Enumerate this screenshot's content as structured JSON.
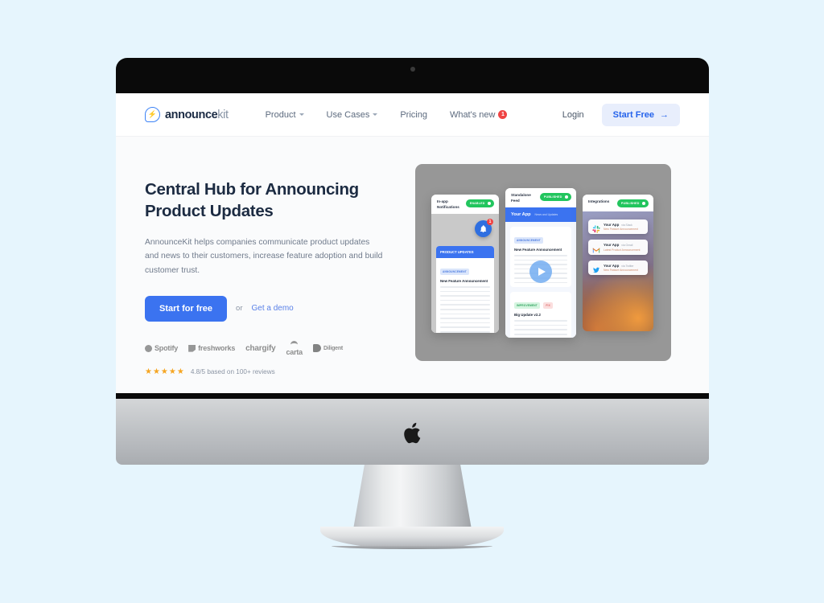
{
  "page": {
    "background_color": "#e6f5fd",
    "device": "imac-desktop-mockup"
  },
  "nav": {
    "brand": {
      "name_bold": "announce",
      "name_light": "kit",
      "icon": "announcekit-chat-logo"
    },
    "links": [
      {
        "label": "Product",
        "has_caret": true,
        "badge": null
      },
      {
        "label": "Use Cases",
        "has_caret": true,
        "badge": null
      },
      {
        "label": "Pricing",
        "has_caret": false,
        "badge": null
      },
      {
        "label": "What's new",
        "has_caret": false,
        "badge": "1"
      }
    ],
    "login_label": "Login",
    "cta_label": "Start Free",
    "cta_arrow": "→",
    "cta_bg": "#e8eefc",
    "cta_color": "#2563eb"
  },
  "hero": {
    "title_line1": "Central Hub for Announcing",
    "title_line2": "Product Updates",
    "subtitle": "AnnounceKit helps companies communicate product updates and news to their customers, increase feature adoption and build customer trust.",
    "primary_cta": "Start for free",
    "or_text": "or",
    "secondary_cta": "Get a demo",
    "primary_cta_bg": "#3b73f0",
    "logos": [
      {
        "name": "Spotify",
        "mark": "dot"
      },
      {
        "name": "freshworks",
        "mark": "square"
      },
      {
        "name": "chargify",
        "mark": "char"
      },
      {
        "name": "carta",
        "mark": "curve"
      },
      {
        "name": "Diligent",
        "mark": "dee"
      }
    ],
    "rating": {
      "stars": "★★★★★",
      "text": "4.8/5 based on 100+ reviews",
      "star_color": "#f5a623"
    }
  },
  "illustration": {
    "panel_color": "#979797",
    "watermark": "",
    "card1": {
      "title": "In-app\nNotifications",
      "pill": "ENABLED",
      "feed_header": "PRODUCT UPDATES",
      "tag": "ANNOUNCEMENT",
      "headline": "New Feature Announcement",
      "bell_count": "1"
    },
    "card2": {
      "title": "Standalone\nFeed",
      "pill": "PUBLISHED",
      "app_name": "Your App",
      "app_sub": "News and Updates",
      "post1": {
        "tag": "ANNOUNCEMENT",
        "headline": "New Feature Announcement"
      },
      "post2": {
        "tag": "IMPROVEMENT",
        "tag2": "FIX",
        "headline": "Big Update v2.2"
      }
    },
    "card3": {
      "title": "Integrations",
      "pill": "PUBLISHED",
      "toasts": [
        {
          "app": "Your App",
          "meta": "via Slack",
          "body": "New Feature Announcement",
          "icon": "slack-icon"
        },
        {
          "app": "Your App",
          "meta": "via Gmail",
          "body": "Latest Product Announcement",
          "icon": "gmail-icon"
        },
        {
          "app": "Your App",
          "meta": "via Twitter",
          "body": "New Feature Announcement",
          "icon": "twitter-icon"
        }
      ]
    }
  }
}
